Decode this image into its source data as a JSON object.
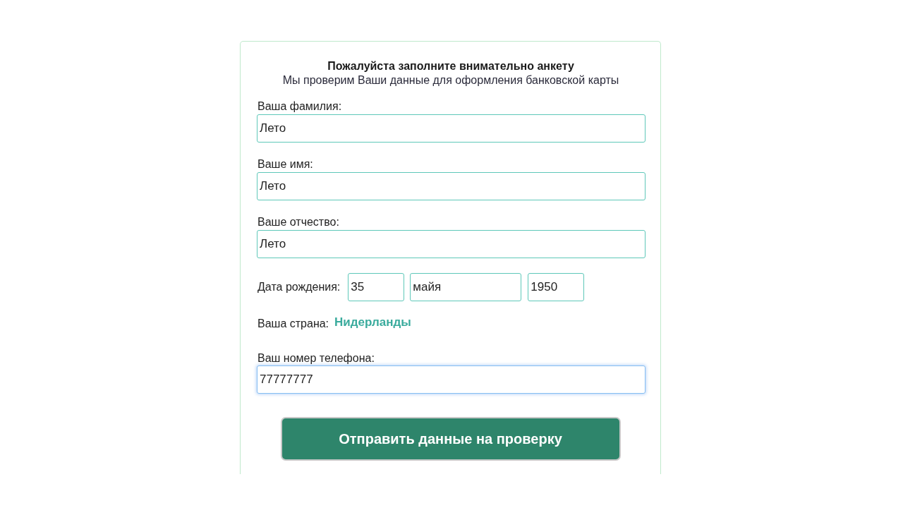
{
  "form": {
    "title": "Пожалуйста заполните внимательно анкету",
    "subtitle": "Мы проверим Ваши данные для оформления банковской карты",
    "name_fields": [
      {
        "label": "Ваша фамилия:",
        "value": "Лето",
        "focused": false
      },
      {
        "label": "Ваше имя:",
        "value": "Лето",
        "focused": false
      },
      {
        "label": "Ваше отчество:",
        "value": "Лето",
        "focused": false
      }
    ],
    "birth_date": {
      "label": "Дата рождения:",
      "day": "35",
      "month": "майя",
      "year": "1950"
    },
    "country": {
      "label": "Ваша страна:",
      "value": "Нидерланды"
    },
    "phone": {
      "label": "Ваш номер телефона:",
      "value": "77777777",
      "focused": true
    },
    "submit_button": "Отправить данные на проверку"
  }
}
